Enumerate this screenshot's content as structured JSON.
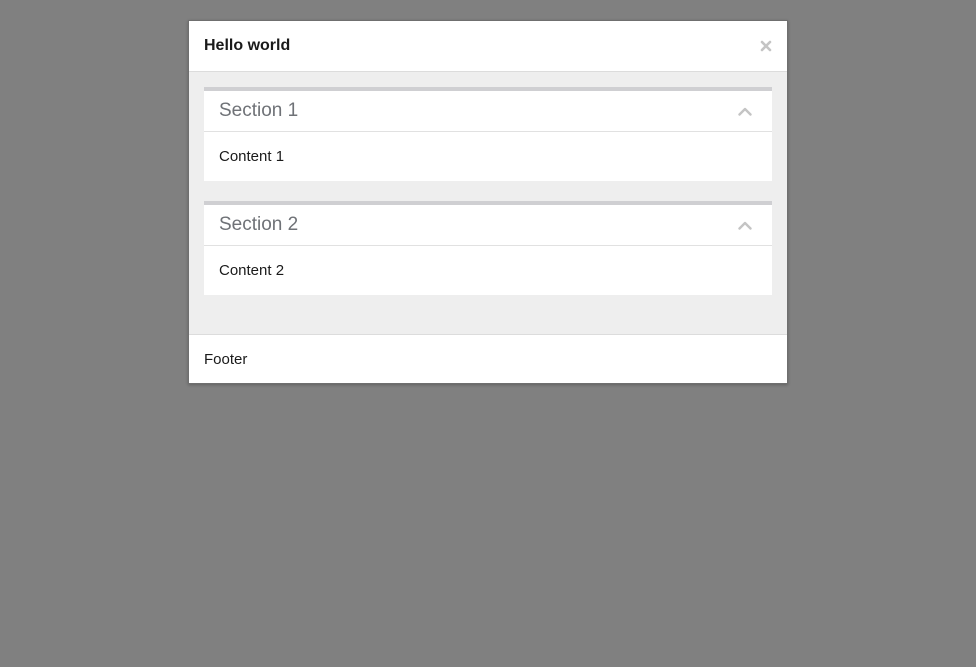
{
  "modal": {
    "title": "Hello world",
    "close_icon": "close-icon",
    "sections": [
      {
        "title": "Section 1",
        "content": "Content 1",
        "toggle_icon": "chevron-up-icon",
        "expanded": true
      },
      {
        "title": "Section 2",
        "content": "Content 2",
        "toggle_icon": "chevron-up-icon",
        "expanded": true
      }
    ],
    "footer": "Footer"
  },
  "colors": {
    "backdrop": "#808080",
    "body_background": "#eeeeee",
    "section_accent": "#cfcfd2",
    "section_title": "#6f7277",
    "icon": "#c4c4c4"
  }
}
